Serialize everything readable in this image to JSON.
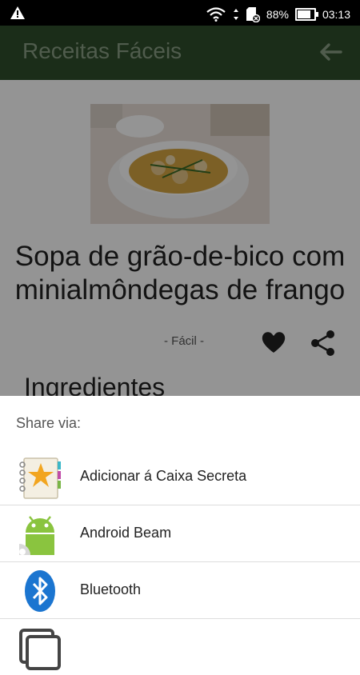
{
  "status_bar": {
    "battery": "88%",
    "battery_level": 0.88,
    "time": "03:13"
  },
  "app_bar": {
    "title": "Receitas Fáceis"
  },
  "recipe": {
    "title_line1": "Sopa de grão-de-bico com",
    "title_line2": "minialmôndegas de frango",
    "difficulty": "- Fácil -",
    "section_title": "Ingredientes"
  },
  "share_sheet": {
    "heading": "Share via:",
    "items": [
      {
        "label": "Adicionar á Caixa Secreta",
        "icon": "notebook-star-icon"
      },
      {
        "label": "Android Beam",
        "icon": "android-beam-icon"
      },
      {
        "label": "Bluetooth",
        "icon": "bluetooth-icon"
      }
    ]
  },
  "colors": {
    "app_bar": "#2f4f2c",
    "bluetooth": "#1b75d0",
    "android_green": "#8ac43f"
  }
}
